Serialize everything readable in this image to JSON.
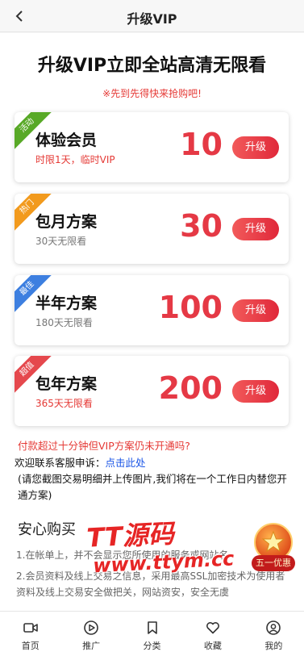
{
  "header": {
    "title": "升级VIP",
    "back_icon": "chevron-left-icon"
  },
  "main": {
    "title": "升级VIP立即全站高清无限看",
    "promo": "※先到先得快来抢购吧!"
  },
  "plans": [
    {
      "tag": "活动",
      "tag_color": "#58a927",
      "name": "体验会员",
      "desc": "时限1天，临时VIP",
      "desc_color": "#e53935",
      "price": "10",
      "button": "升级"
    },
    {
      "tag": "热门",
      "tag_color": "#f29a1d",
      "name": "包月方案",
      "desc": "30天无限看",
      "desc_color": "#777777",
      "price": "30",
      "button": "升级"
    },
    {
      "tag": "最佳",
      "tag_color": "#3d7fe0",
      "name": "半年方案",
      "desc": "180天无限看",
      "desc_color": "#777777",
      "price": "100",
      "button": "升级"
    },
    {
      "tag": "超值",
      "tag_color": "#e5484d",
      "name": "包年方案",
      "desc": "365天无限看",
      "desc_color": "#e53935",
      "price": "200",
      "button": "升级"
    }
  ],
  "notice": {
    "question": "付款超过十分钟但VIP方案仍未开通吗?",
    "contact_prefix": "欢迎联系客服申诉：",
    "contact_link": "点击此处",
    "upload_note": "(请您截图交易明细并上传图片,我们将在一个工作日内替您开通方案)"
  },
  "secure": {
    "title": "安心购买",
    "p1": "1.在帐单上，并不会显示您所使用的服务或网站名",
    "p2": "2.会员资料及线上交易之信息，采用最高SSL加密技术为使用者资料及线上交易安全做把关，网站资安，安全无虞"
  },
  "overlay": {
    "watermark_line1": "TT源码",
    "watermark_line2": "www.ttym.cc",
    "badge_label": "五一优惠"
  },
  "tabbar": [
    {
      "label": "首页",
      "icon": "video-icon"
    },
    {
      "label": "推广",
      "icon": "play-circle-icon"
    },
    {
      "label": "分类",
      "icon": "bookmark-icon"
    },
    {
      "label": "收藏",
      "icon": "heart-icon"
    },
    {
      "label": "我的",
      "icon": "user-icon"
    }
  ]
}
